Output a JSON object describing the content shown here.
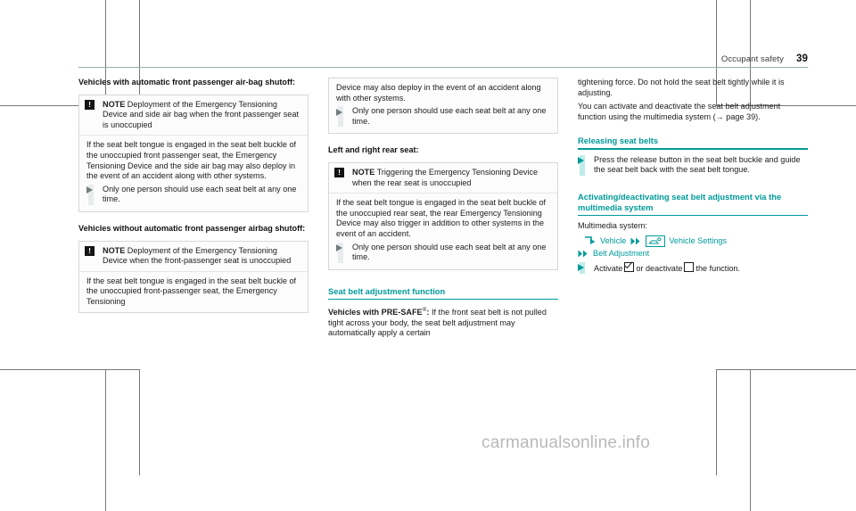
{
  "header": {
    "running_title": "Occupant safety",
    "page_number": "39"
  },
  "watermark": "carmanualsonline.info",
  "column1": {
    "heading": "Vehicles with automatic front passenger air-bag shutoff:",
    "note1": {
      "icon": "exclamation-icon",
      "label": "NOTE",
      "title": " Deployment of the Emergency Tensioning Device and side air bag when the front passenger seat is unoccupied",
      "body": "If the seat belt tongue is engaged in the seat belt buckle of the unoccupied front passenger seat, the Emergency Tensioning Device and the side air bag may also deploy in the event of an accident along with other systems.",
      "step": "Only one person should use each seat belt at any one time."
    },
    "heading2": "Vehicles without automatic front passenger airbag shutoff:",
    "note2": {
      "icon": "exclamation-icon",
      "label": "NOTE",
      "title": " Deployment of the Emergency Tensioning Device when the front-passenger seat is unoccupied",
      "body": "If the seat belt tongue is engaged in the seat belt buckle of the unoccupied front-passenger seat, the Emergency Tensioning"
    }
  },
  "column2": {
    "note2_continued": {
      "body": "Device may also deploy in the event of an accident along with other systems.",
      "step": "Only one person should use each seat belt at any one time."
    },
    "heading": "Left and right rear seat:",
    "note3": {
      "icon": "exclamation-icon",
      "label": "NOTE",
      "title": " Triggering the Emergency Tensioning Device when the rear seat is unoccupied",
      "body": "If the seat belt tongue is engaged in the seat belt buckle of the unoccupied rear seat, the rear Emergency Tensioning Device may also trigger in addition to other systems in the event of an accident.",
      "step": "Only one person should use each seat belt at any one time."
    },
    "section_heading": "Seat belt adjustment function",
    "presafe_lead": "Vehicles with PRE-SAFE",
    "presafe_reg": "®",
    "presafe_colon": ":",
    "presafe_body": " If the front seat belt is not pulled tight across your body, the seat belt adjustment may automatically apply a certain"
  },
  "column3": {
    "para1": "tightening force. Do not hold the seat belt tightly while it is adjusting.",
    "para2_a": "You can activate and deactivate the seat belt adjustment function using the multimedia system (",
    "para2_ref": "→ page 39",
    "para2_b": ").",
    "section_heading1": "Releasing seat belts",
    "step1": "Press the release button in the seat belt buckle and guide the seat belt back with the seat belt tongue.",
    "section_heading2": "Activating/deactivating seat belt adjustment via the multimedia system",
    "mm_label": "Multimedia system:",
    "nav_path": {
      "start_icon": "nav-arrow-icon",
      "item1": "Vehicle",
      "sep1_icon": "double-chevron-icon",
      "item2_icon": "vehicle-settings-icon",
      "item2": "Vehicle Settings",
      "sep2_icon": "double-chevron-icon",
      "item3": "Belt Adjustment"
    },
    "activate_pre": "Activate",
    "activate_mid": "or deactivate",
    "activate_post": "the function.",
    "checkbox_checked_icon": "checkbox-checked-icon",
    "checkbox_unchecked_icon": "checkbox-unchecked-icon"
  },
  "colors": {
    "accent_teal": "#009a9a",
    "rule_gray": "#8fb0ac",
    "note_border": "#d8d8d8",
    "bullet_gray": "#6f7d7d",
    "bullet_bar_gray": "#e9eced",
    "bullet_bar_teal": "#bdeceb",
    "watermark_gray": "#b9b9b9"
  }
}
